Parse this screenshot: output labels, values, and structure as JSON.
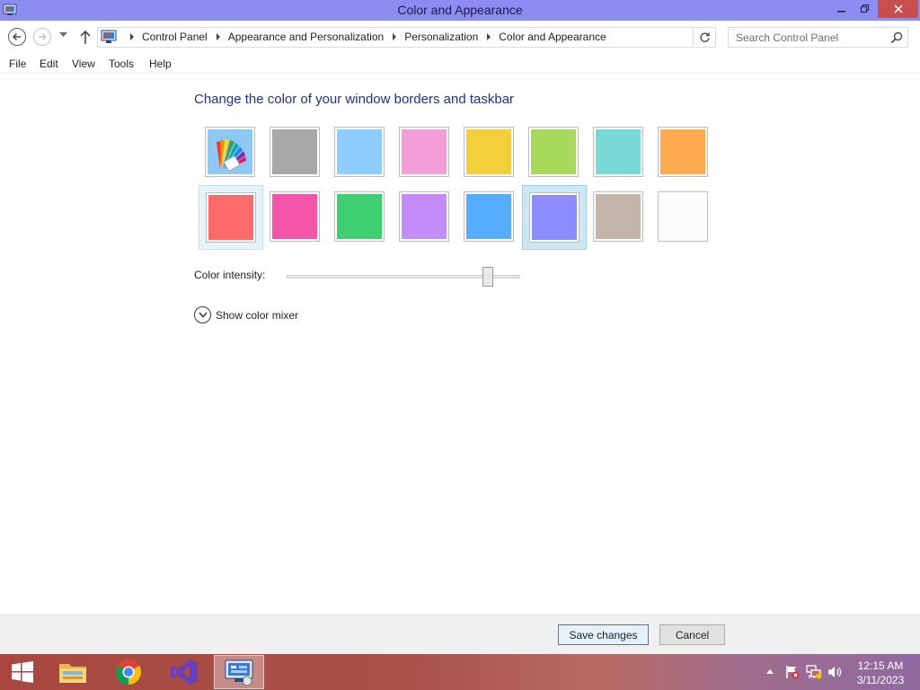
{
  "window": {
    "title": "Color and Appearance"
  },
  "address": {
    "crumbs": [
      "Control Panel",
      "Appearance and Personalization",
      "Personalization",
      "Color and Appearance"
    ]
  },
  "search": {
    "placeholder": "Search Control Panel"
  },
  "menu": [
    "File",
    "Edit",
    "View",
    "Tools",
    "Help"
  ],
  "content": {
    "heading": "Change the color of your window borders and taskbar",
    "swatches_row1": [
      "automatic",
      "#a8a8a8",
      "#8ecdff",
      "#f29ed7",
      "#f2d03c",
      "#a8d95c",
      "#79d9d4",
      "#ffab4f"
    ],
    "swatches_row2": [
      "#ff6b6b",
      "#f555a9",
      "#3ecf70",
      "#c48cf7",
      "#55adff",
      "#8c8cff",
      "#c3b5a9",
      "#fcfcfc"
    ],
    "selected_swatch": "#8c8cff",
    "intensity_label": "Color intensity:",
    "intensity_value": 0.86,
    "mixer_label": "Show color mixer"
  },
  "buttons": {
    "save": "Save changes",
    "cancel": "Cancel"
  },
  "taskbar": {
    "time": "12:15 AM",
    "date": "3/11/2023"
  }
}
